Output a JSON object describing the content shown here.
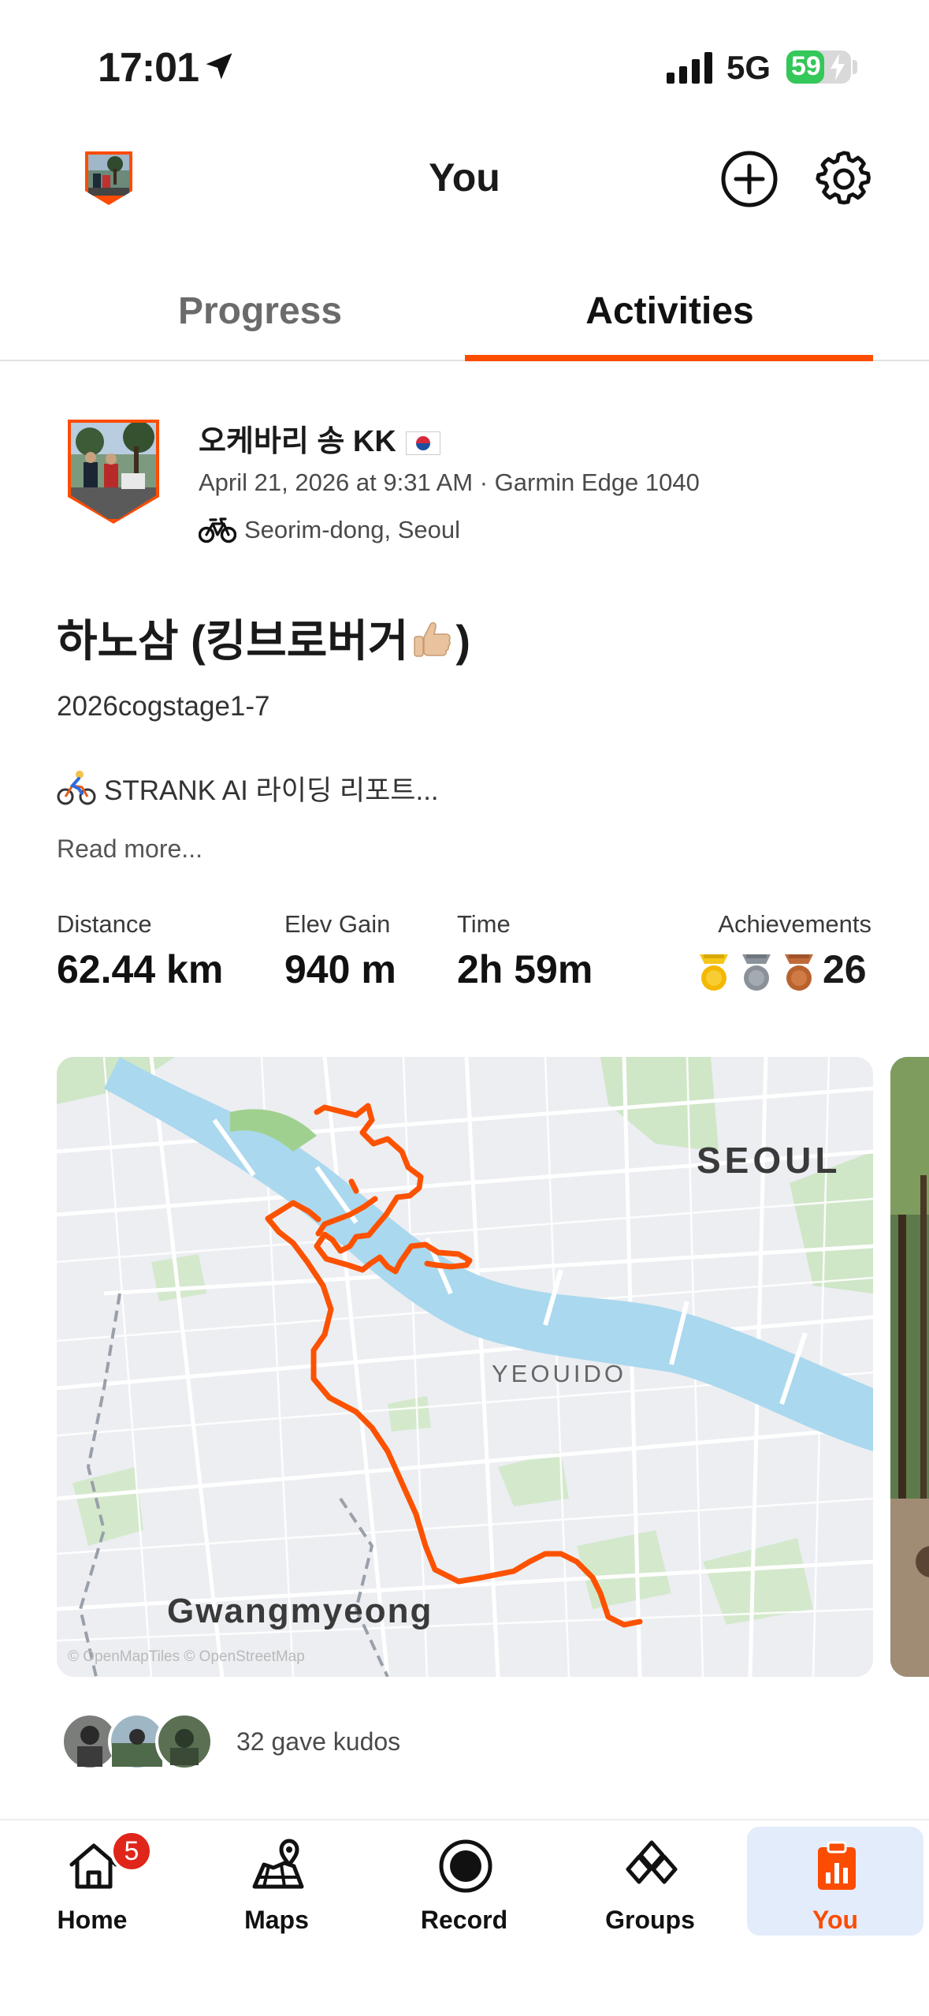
{
  "status_bar": {
    "time": "17:01",
    "network": "5G",
    "battery": "59",
    "battery_level": 0.59
  },
  "header": {
    "title": "You"
  },
  "tabs": [
    {
      "label": "Progress",
      "active": false
    },
    {
      "label": "Activities",
      "active": true
    }
  ],
  "activity": {
    "athlete_name": "오케바리 송 KK",
    "meta": "April 21, 2026 at 9:31 AM · Garmin Edge 1040",
    "location": "Seorim-dong, Seoul",
    "title_part1": "하노삼 (킹브로버거",
    "title_part2": ")",
    "description": "2026cogstage1-7",
    "ai_report": "STRANK AI 라이딩 리포트...",
    "read_more": "Read more...",
    "stats": {
      "distance_label": "Distance",
      "distance_value": "62.44 km",
      "elev_label": "Elev Gain",
      "elev_value": "940 m",
      "time_label": "Time",
      "time_value": "2h 59m",
      "achievements_label": "Achievements",
      "achievements_value": "26"
    },
    "map": {
      "label_seoul": "SEOUL",
      "label_yeouido": "YEOUIDO",
      "label_gwangmyeong": "Gwangmyeong",
      "attribution": "© OpenMapTiles © OpenStreetMap",
      "route_color": "#fc5200"
    },
    "kudos_text": "32 gave kudos"
  },
  "tab_bar": {
    "items": [
      {
        "label": "Home",
        "icon": "home-icon",
        "badge": "5"
      },
      {
        "label": "Maps",
        "icon": "maps-icon"
      },
      {
        "label": "Record",
        "icon": "record-icon"
      },
      {
        "label": "Groups",
        "icon": "groups-icon"
      },
      {
        "label": "You",
        "icon": "you-icon",
        "active": true
      }
    ]
  },
  "colors": {
    "accent": "#fc4c02",
    "active_tab_bg": "#e3ecfb"
  }
}
